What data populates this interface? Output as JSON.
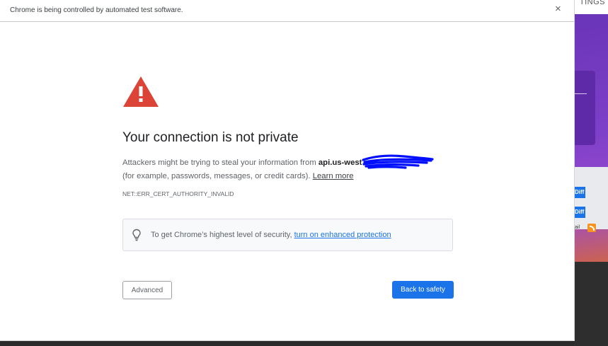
{
  "infobar": {
    "message": "Chrome is being controlled by automated test software.",
    "close_icon": "×"
  },
  "background": {
    "top_right_text": "TINGS",
    "buttons": [
      "Diff",
      "Diff"
    ],
    "mail_label": "ail",
    "rss_icon": "rss-icon"
  },
  "interstitial": {
    "warning_icon": "warning-triangle-icon",
    "title": "Your connection is not private",
    "description_prefix": "Attackers might be trying to steal your information from ",
    "host": "api.us-west",
    "description_suffix": "(for example, passwords, messages, or credit cards). ",
    "learn_more": "Learn more",
    "error_code": "NET::ERR_CERT_AUTHORITY_INVALID",
    "enhanced_icon": "lightbulb-icon",
    "enhanced_text": "To get Chrome’s highest level of security, ",
    "enhanced_link": "turn on enhanced protection",
    "advanced_button": "Advanced",
    "back_button": "Back to safety"
  },
  "colors": {
    "primary_blue": "#1a73e8",
    "warning_red": "#db4437",
    "redaction_blue": "#0010ff"
  }
}
